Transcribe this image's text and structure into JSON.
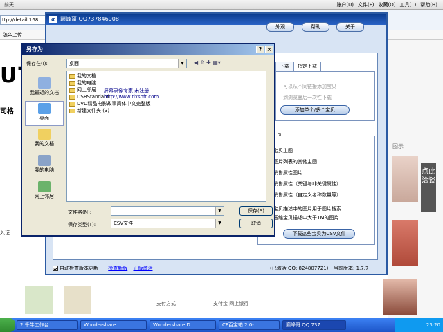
{
  "browser": {
    "menu": [
      "账户(U)",
      "文件(F)",
      "收藏(O)",
      "工具(T)",
      "帮助(H)"
    ],
    "tab_text": "前天...",
    "url": "ttp://detail.168",
    "favorites": [
      "怎么上传",
      "20"
    ],
    "brand_text": "UT",
    "side_text": "司格",
    "side_text2": "入证",
    "float_tab": "点此洽谈",
    "right_text": "图示",
    "page_bottom": [
      "支付方式",
      "支付宝  网上银行"
    ]
  },
  "main_window": {
    "title": "巅峰哥 QQ737846908",
    "logo": "α",
    "buttons": {
      "appearance": "外观",
      "help": "帮助",
      "about": "关于"
    },
    "tabs": [
      "下载",
      "指定下载"
    ],
    "gray_options": [
      "可以从不同链接添加宝贝",
      "到浏览器后一次性下载"
    ],
    "add_button": "添加单个/多个宝贝",
    "section_label": "贝",
    "options": [
      "下载宝贝主图",
      "下载图片列表的其他主图",
      "下载销售属性图片",
      "下载销售属性（关键与非关键属性）",
      "下载销售属性（自定义名称数量等）",
      "下载宝贝描述中的图片用于图片搜索",
      "智能压缩宝贝描述中大于1M的图片"
    ],
    "export_button": "下载这些宝贝为CSV文件",
    "footer": {
      "auto_update": "自动检查版本更新",
      "check_version": "检查新版",
      "buy": "正版激活",
      "activated": "(已激活  QQ: 824807721)",
      "version": "当前版本: 1.7.7"
    }
  },
  "save_dialog": {
    "title": "另存为",
    "save_in_label": "保存在(I):",
    "save_in_value": "桌面",
    "places": [
      "我最近的文档",
      "桌面",
      "我的文档",
      "我的电脑",
      "网上邻居"
    ],
    "files": [
      "我的文档",
      "我的电脑",
      "网上邻居",
      "DSBStandard",
      "DVD精品电影故事简体中文完整版",
      "新建文件夹 (3)"
    ],
    "filename_label": "文件名(N):",
    "filename_value": "",
    "filetype_label": "保存类型(T):",
    "filetype_value": "CSV文件",
    "save_button": "保存(S)",
    "cancel_button": "取消",
    "watermark_1": "屏幕录像专家    未注册",
    "watermark_2": "http://www.tlxsoft.com"
  },
  "taskbar": {
    "items": [
      "2 千牛工作台",
      "Wondershare ...",
      "Wondershare D...",
      "CF百宝箱 2.0-...",
      "巅峰哥 QQ 737..."
    ],
    "clock": "23:20"
  },
  "colors": {
    "titlebar": "#0b3d91",
    "dialog_title": "#0a246a",
    "taskbar": "#2a63d8"
  }
}
